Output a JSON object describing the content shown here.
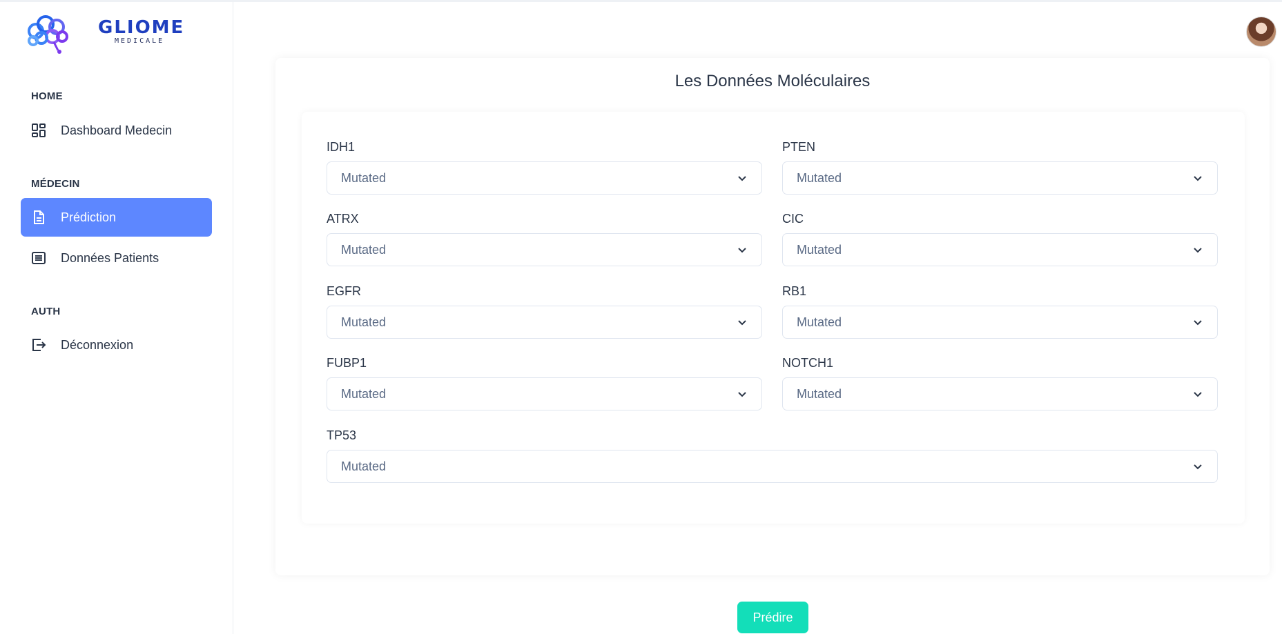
{
  "logo": {
    "title": "GLIOME",
    "subtitle": "MEDICALE"
  },
  "sidebar": {
    "sections": [
      {
        "caption": "HOME",
        "items": [
          {
            "label": "Dashboard Medecin",
            "icon": "dashboard-icon"
          }
        ]
      },
      {
        "caption": "MÉDECIN",
        "items": [
          {
            "label": "Prédiction",
            "icon": "document-icon",
            "active": true
          },
          {
            "label": "Données Patients",
            "icon": "list-icon"
          }
        ]
      },
      {
        "caption": "AUTH",
        "items": [
          {
            "label": "Déconnexion",
            "icon": "logout-icon"
          }
        ]
      }
    ]
  },
  "main": {
    "title": "Les Données Moléculaires",
    "fields": [
      {
        "label": "IDH1",
        "value": "Mutated"
      },
      {
        "label": "PTEN",
        "value": "Mutated"
      },
      {
        "label": "ATRX",
        "value": "Mutated"
      },
      {
        "label": "CIC",
        "value": "Mutated"
      },
      {
        "label": "EGFR",
        "value": "Mutated"
      },
      {
        "label": "RB1",
        "value": "Mutated"
      },
      {
        "label": "FUBP1",
        "value": "Mutated"
      },
      {
        "label": "NOTCH1",
        "value": "Mutated"
      },
      {
        "label": "TP53",
        "value": "Mutated"
      }
    ],
    "submit_label": "Prédire"
  },
  "colors": {
    "accent": "#5d87ff",
    "submit": "#13deb9",
    "text": "#2a3547",
    "brand": "#1f3fbf"
  }
}
